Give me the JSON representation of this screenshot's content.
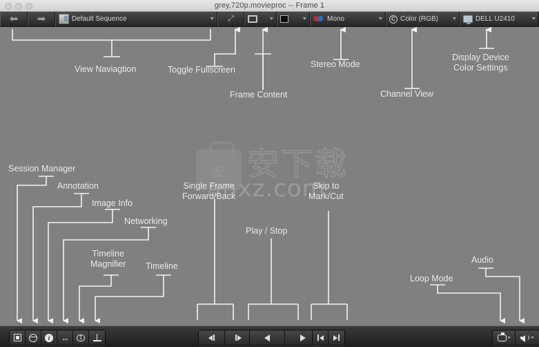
{
  "window": {
    "title": "grey,720p.movieproc -- Frame 1",
    "controls": [
      "close",
      "minimize",
      "zoom"
    ]
  },
  "toolbar": {
    "back_icon": "back-arrow-icon",
    "forward_icon": "forward-arrow-icon",
    "sequence": {
      "label": "Default Sequence",
      "icon": "sequence-icon"
    },
    "tool": {
      "icon": "wrench-icon"
    },
    "frame_content": {
      "icon": "frame-icon"
    },
    "color_swatch": {
      "icon": "color-swatch-icon",
      "color": "#0d0d0d"
    },
    "stereo_mode": {
      "label": "Mono",
      "icon": "stereo-glasses-icon"
    },
    "channel_view": {
      "label": "Color (RGB)",
      "icon": "channel-circle-icon"
    },
    "display_device": {
      "label": "DELL U2410",
      "icon": "monitor-icon"
    },
    "caret": "▼"
  },
  "transport": {
    "left_tools": [
      {
        "name": "session-manager",
        "icon": "session-manager-icon"
      },
      {
        "name": "annotation",
        "icon": "annotation-globe-icon"
      },
      {
        "name": "image-info",
        "icon": "info-icon"
      },
      {
        "name": "networking",
        "icon": "network-arrows-icon"
      },
      {
        "name": "timeline-magnifier",
        "icon": "magnifier-icon"
      },
      {
        "name": "timeline",
        "icon": "timeline-icon"
      }
    ],
    "step_back": "step-back-icon",
    "step_forward": "step-forward-icon",
    "play_back": "play-reverse-icon",
    "play_forward": "play-forward-icon",
    "skip_prev": "skip-to-start-icon",
    "skip_next": "skip-to-end-icon",
    "loop_mode": "loop-icon",
    "audio": "speaker-icon",
    "mini_caret": "▾"
  },
  "annotations": [
    {
      "id": "view-navigation",
      "label": "View Naviagtion"
    },
    {
      "id": "toggle-fullscreen",
      "label": "Toggle Fullscreen"
    },
    {
      "id": "frame-content",
      "label": "Frame Content"
    },
    {
      "id": "stereo-mode",
      "label": "Stereo Mode"
    },
    {
      "id": "channel-view",
      "label": "Channel View"
    },
    {
      "id": "display-device-color",
      "label": "Display Device\nColor Settings"
    },
    {
      "id": "session-manager",
      "label": "Session Manager"
    },
    {
      "id": "annotation",
      "label": "Annotation"
    },
    {
      "id": "image-info",
      "label": "Image Info"
    },
    {
      "id": "networking",
      "label": "Networking"
    },
    {
      "id": "timeline-magnifier",
      "label": "Timeline\nMagnifier"
    },
    {
      "id": "timeline",
      "label": "Timeline"
    },
    {
      "id": "single-frame-fwd-back",
      "label": "Single Frame\nForward/Back"
    },
    {
      "id": "play-stop",
      "label": "Play / Stop"
    },
    {
      "id": "skip-to-mark-cut",
      "label": "Skip to\nMark/Cut"
    },
    {
      "id": "loop-mode",
      "label": "Loop Mode"
    },
    {
      "id": "audio",
      "label": "Audio"
    }
  ],
  "watermark": {
    "chinese": "安下载",
    "latin": "anxz.com"
  },
  "colors": {
    "canvas": "#808080",
    "annotation_text": "#f2f2f2",
    "toolbar_dark": "#2b2b2b",
    "titlebar": "#e2e2e2"
  }
}
